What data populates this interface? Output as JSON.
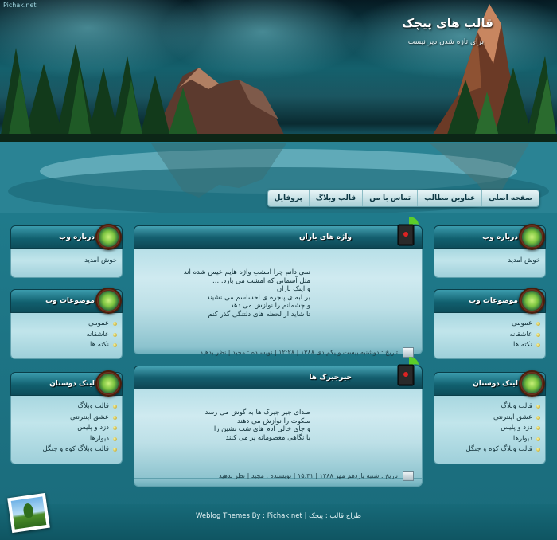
{
  "header": {
    "watermark": "Pichak.net",
    "title": "قالب های پیچک",
    "description": "برای تازه شدن دیر نیست"
  },
  "nav": {
    "items": [
      {
        "label": "صفحه اصلی"
      },
      {
        "label": "عناوین مطالب"
      },
      {
        "label": "تماس با من"
      },
      {
        "label": "قالب وبلاگ"
      },
      {
        "label": "پروفایل"
      }
    ]
  },
  "left_sidebar": {
    "about": {
      "title": "درباره وب",
      "text": "خوش آمدید"
    },
    "topics": {
      "title": "موضوعات وب",
      "items": [
        "عمومی",
        "عاشقانه",
        "نکته ها"
      ]
    },
    "links": {
      "title": "لینک دوستان",
      "items": [
        "قالب وبلاگ",
        "عشق اینترنتی",
        "دزد و پلیس",
        "دیوارها",
        "قالب وبلاگ کوه و جنگل"
      ]
    }
  },
  "right_sidebar": {
    "about": {
      "title": "درباره وب",
      "text": "خوش آمدید"
    },
    "topics": {
      "title": "موضوعات وب",
      "items": [
        "عمومی",
        "عاشقانه",
        "نکته ها"
      ]
    },
    "links": {
      "title": "لینک دوستان",
      "items": [
        "قالب وبلاگ",
        "عشق اینترنتی",
        "دزد و پلیس",
        "دیوارها",
        "قالب وبلاگ کوه و جنگل"
      ]
    }
  },
  "posts": [
    {
      "title": "واژه های باران",
      "lines": [
        "نمی دانم چرا امشب واژه هایم خیس شده اند",
        "مثل آسمانی که امشب می بارد.....",
        "و اینک باران",
        "بر لبه ی پنجره ی احساسم می نشیند",
        "و چشمانم را نوازش می دهد",
        "تا شاید از لحظه های دلتنگی گذر کنم"
      ],
      "meta": "تاریخ : دوشنبه بیست و یکم دی ۱۳۸۸ | ۱۲:۲۸ | نویسنده : مجید | نظر بدهید"
    },
    {
      "title": "جیرجیرک ها",
      "lines": [
        "صدای جیر جیرک ها به گوش می رسد",
        "سکوت را نوازش می دهند",
        "و جای خالی آدم های شب نشین را",
        "با نگاهی معصومانه پر می کنند"
      ],
      "meta": "تاریخ : شنبه یازدهم مهر ۱۳۸۸ | ۱۵:۴۱ | نویسنده : مجید | نظر بدهید"
    }
  ],
  "footer": {
    "text": "Weblog Themes By : Pichak.net | طراح قالب : پیچک"
  },
  "colors": {
    "accent": "#11606f",
    "box_body": "#a8d7e0",
    "footer": "#176a79"
  }
}
